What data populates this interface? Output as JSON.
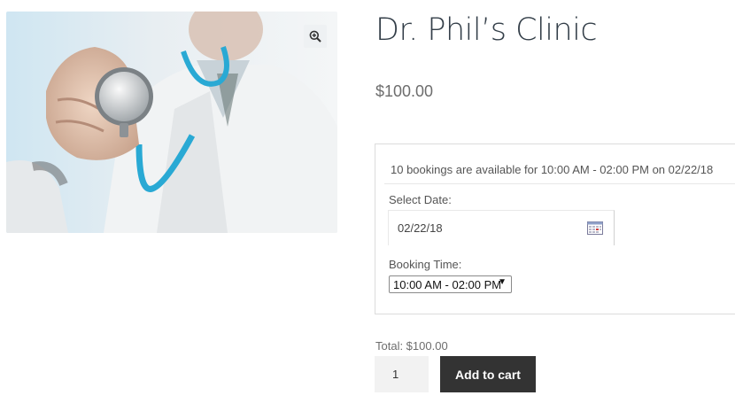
{
  "product": {
    "title": "Dr. Phil’s Clinic",
    "price": "$100.00",
    "image": {
      "description_icon": "doctor-stethoscope-image",
      "zoom_icon": "zoom-in-icon"
    }
  },
  "booking": {
    "availability": "10 bookings are available for 10:00 AM - 02:00 PM on 02/22/18",
    "date_label": "Select Date:",
    "date_value": "02/22/18",
    "calendar_icon": "calendar-icon",
    "time_label": "Booking Time:",
    "time_selected": "10:00 AM - 02:00 PM"
  },
  "cart": {
    "total": "Total: $100.00",
    "quantity": "1",
    "add_to_cart_label": "Add to cart"
  },
  "colors": {
    "title": "#333e48",
    "button_bg": "#333333",
    "stethoscope_tube": "#29a9d4"
  }
}
